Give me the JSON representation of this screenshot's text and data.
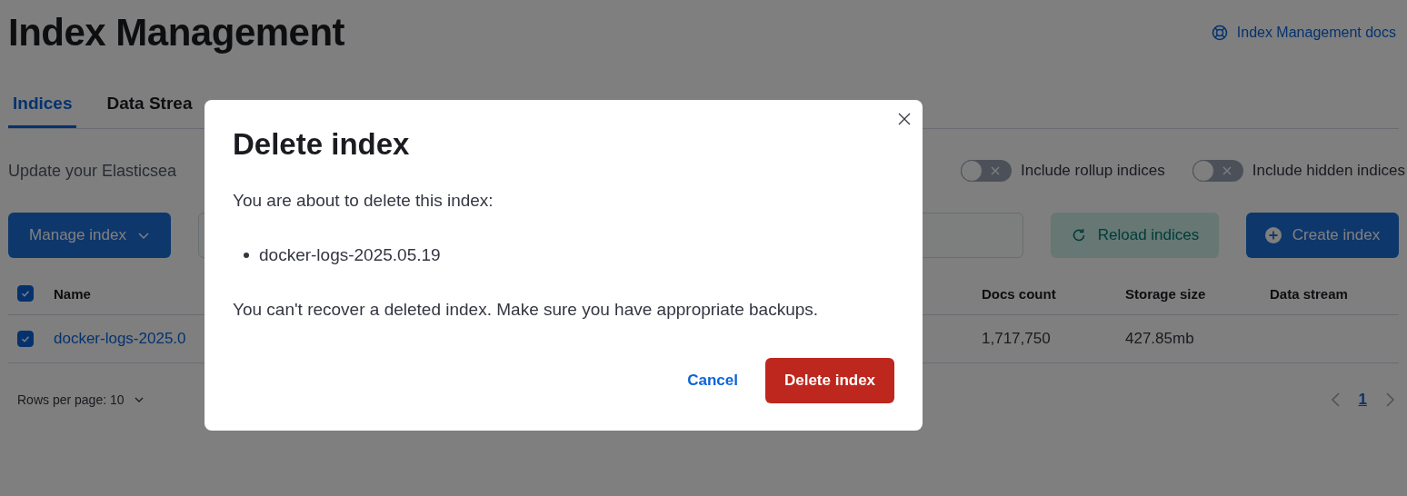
{
  "header": {
    "title": "Index Management",
    "docs_link": "Index Management docs"
  },
  "tabs": [
    {
      "label": "Indices",
      "selected": true
    },
    {
      "label": "Data Strea",
      "selected": false
    }
  ],
  "description": "Update your Elasticsea",
  "toggles": [
    {
      "label": "Include rollup indices",
      "on": false
    },
    {
      "label": "Include hidden indices",
      "on": false
    }
  ],
  "toolbar": {
    "manage_button": "Manage index",
    "reload_button": "Reload indices",
    "create_button": "Create index"
  },
  "table": {
    "header_checked": true,
    "columns": [
      {
        "label": "Name"
      },
      {
        "label": "Docs count"
      },
      {
        "label": "Storage size"
      },
      {
        "label": "Data stream"
      }
    ],
    "rows": [
      {
        "checked": true,
        "cells": [
          "docker-logs-2025.0",
          "1,717,750",
          "427.85mb"
        ]
      }
    ]
  },
  "footer": {
    "rows_per_page": "Rows per page: 10",
    "pages": [
      {
        "label": "1",
        "selected": true
      }
    ]
  },
  "modal": {
    "title": "Delete index",
    "intro": "You are about to delete this index:",
    "items": [
      "docker-logs-2025.05.19"
    ],
    "warning": "You can't recover a deleted index. Make sure you have appropriate backups.",
    "cancel": "Cancel",
    "confirm": "Delete index"
  }
}
